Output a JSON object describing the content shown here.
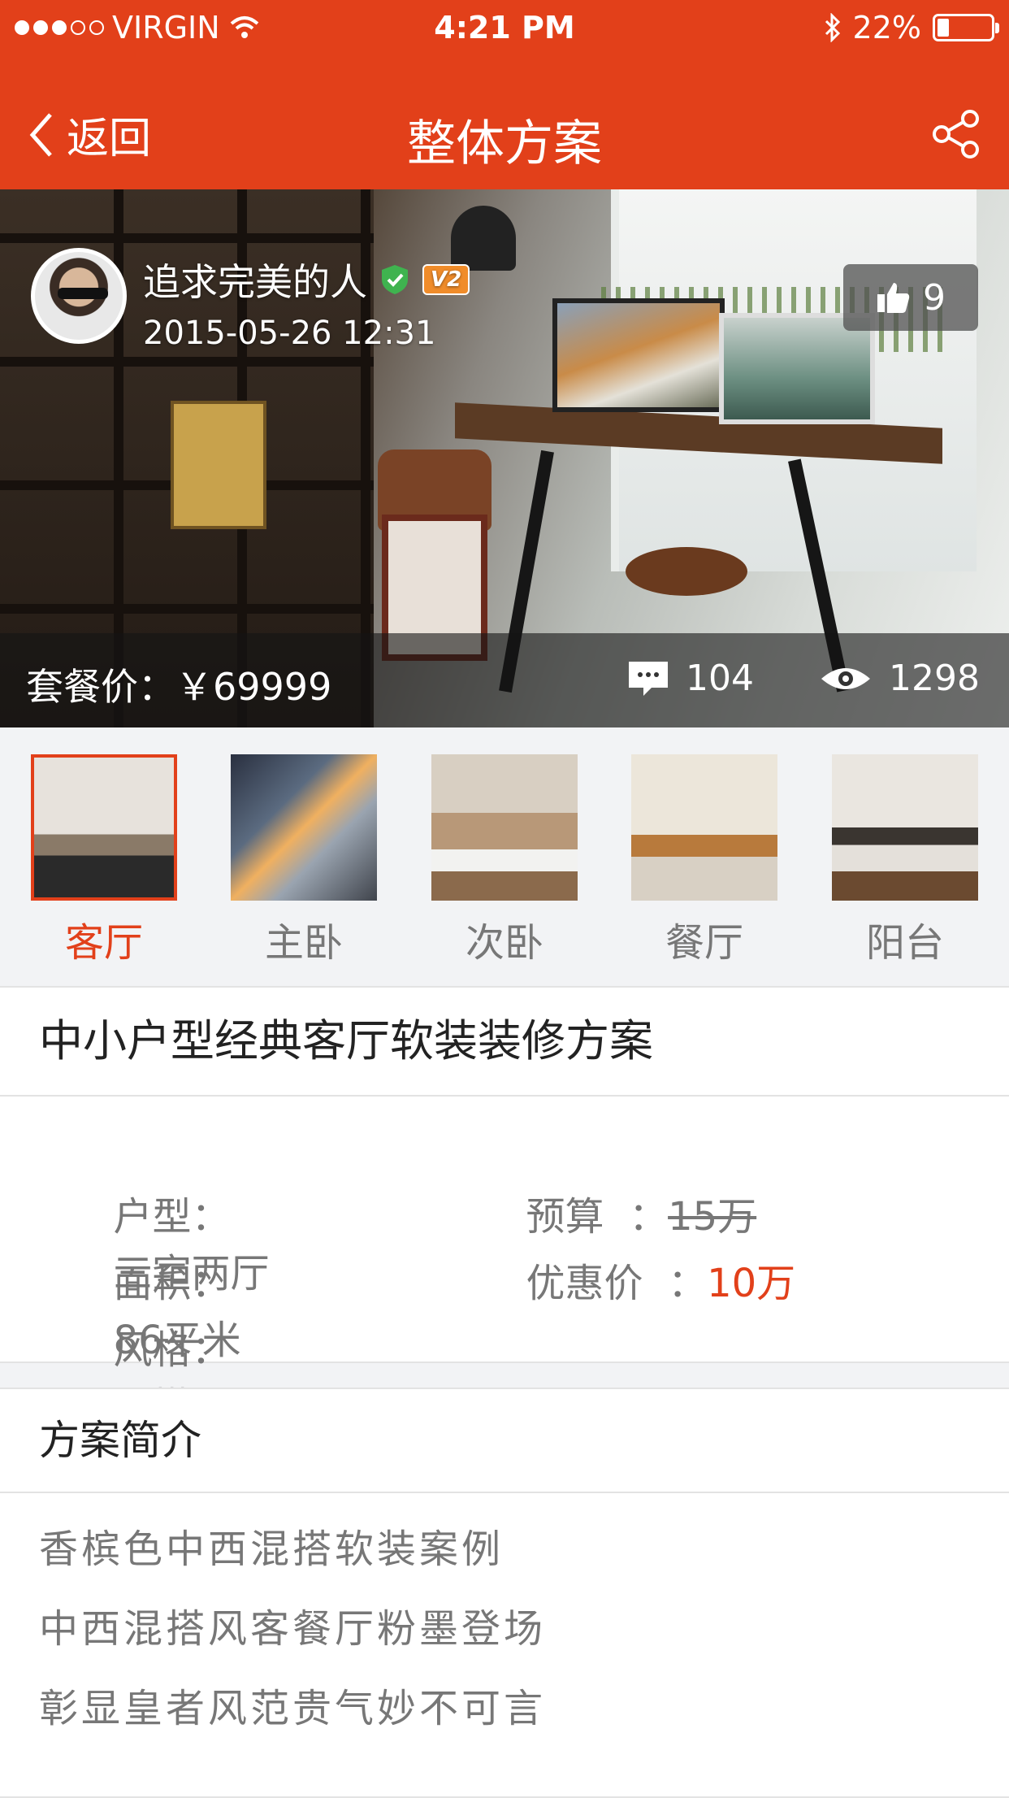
{
  "status": {
    "carrier": "VIRGIN",
    "time": "4:21 PM",
    "battery": "22%",
    "battery_level": 0.22
  },
  "nav": {
    "back_label": "返回",
    "title": "整体方案"
  },
  "author": {
    "name": "追求完美的人",
    "level_badge": "V2",
    "date": "2015-05-26  12:31"
  },
  "likes": "9",
  "price_label": "套餐价：",
  "price_value": "￥69999",
  "comments": "104",
  "views": "1298",
  "rooms": [
    {
      "label": "客厅",
      "active": true
    },
    {
      "label": "主卧",
      "active": false
    },
    {
      "label": "次卧",
      "active": false
    },
    {
      "label": "餐厅",
      "active": false
    },
    {
      "label": "阳台",
      "active": false
    }
  ],
  "plan": {
    "title": "中小户型经典客厅软装装修方案",
    "layout_label": "户型：",
    "layout_value": "三室两厅",
    "area_label": "面积：",
    "area_value": "86平米",
    "style_label": "风格：",
    "style_value": "混搭",
    "budget_label": "预算  ：",
    "budget_value": "15万",
    "discount_label": "优惠价  ：",
    "discount_value": "10万"
  },
  "intro": {
    "title": "方案简介",
    "lines": [
      "香槟色中西混搭软装案例",
      "中西混搭风客餐厅粉墨登场",
      "彰显皇者风范贵气妙不可言"
    ]
  },
  "colors": {
    "brand": "#e2401a",
    "text_muted": "#777777"
  }
}
